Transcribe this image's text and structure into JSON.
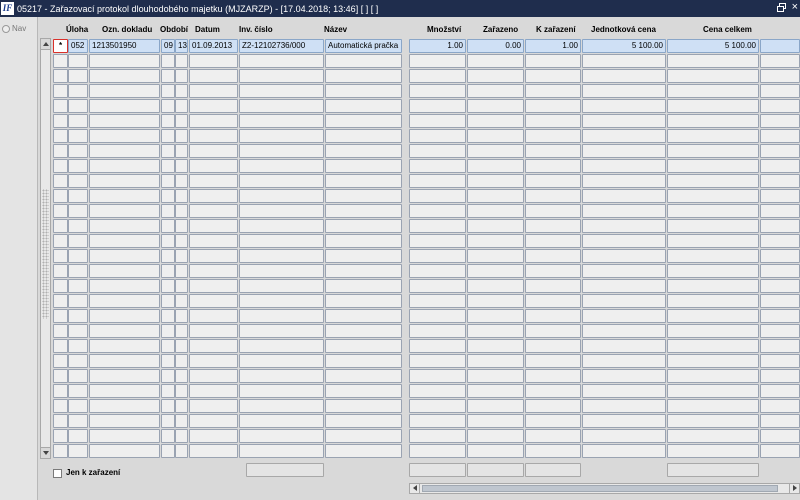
{
  "window": {
    "title": "05217 - Zařazovací protokol dlouhodobého majetku (MJZARZP) - [17.04.2018; 13:46]  [ ] [ ]",
    "logo_text": "IF"
  },
  "nav": {
    "label": "Nav"
  },
  "columns": {
    "uloha": "Úloha",
    "ozn_dokladu": "Ozn. dokladu",
    "obdobi": "Období",
    "datum": "Datum",
    "inv_cislo": "Inv. číslo",
    "nazev": "Název",
    "mnozstvi": "Množství",
    "zarazeno": "Zařazeno",
    "k_zarazeni": "K zařazení",
    "jednotkova_cena": "Jednotková cena",
    "cena_celkem": "Cena celkem"
  },
  "rows": [
    {
      "marker": "*",
      "uloha": "052",
      "ozn_dokladu": "1213501950",
      "obdobi_rok": "09",
      "obdobi_mesic": "13",
      "datum": "01.09.2013",
      "inv_cislo": "Z2-12102736/000",
      "nazev": "Automatická pračka",
      "mnozstvi": "1.00",
      "zarazeno": "0.00",
      "k_zarazeni": "1.00",
      "jednotkova_cena": "5 100.00",
      "cena_celkem": "5 100.00"
    }
  ],
  "empty_row_count": 27,
  "filter": {
    "jen_k_zarazeni_label": "Jen k zařazení",
    "jen_k_zarazeni_checked": false
  },
  "colors": {
    "titlebar": "#1f2d4d",
    "selected_row": "#cfe0f5",
    "cell": "#efefef",
    "marker_border": "#d9302a"
  }
}
